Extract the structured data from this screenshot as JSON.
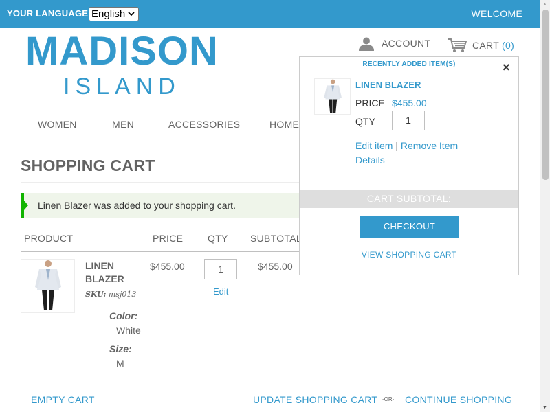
{
  "header": {
    "language_label": "YOUR LANGUAGE:",
    "language_selected": "English",
    "welcome": "WELCOME"
  },
  "logo": {
    "main": "MADISON",
    "sub": "ISLAND"
  },
  "account": {
    "label": "ACCOUNT"
  },
  "cart": {
    "label": "CART",
    "count": "(0)"
  },
  "nav": {
    "items": [
      "WOMEN",
      "MEN",
      "ACCESSORIES",
      "HOME"
    ]
  },
  "page": {
    "title": "SHOPPING CART",
    "success_message": "Linen Blazer was added to your shopping cart."
  },
  "table": {
    "headers": {
      "product": "PRODUCT",
      "price": "PRICE",
      "qty": "QTY",
      "subtotal": "SUBTOTAL"
    },
    "row": {
      "name": "LINEN BLAZER",
      "sku_label": "SKU:",
      "sku": "msj013",
      "color_label": "Color:",
      "color": "White",
      "size_label": "Size:",
      "size": "M",
      "price": "$455.00",
      "qty": "1",
      "edit": "Edit",
      "subtotal": "$455.00"
    }
  },
  "footer": {
    "empty_cart": "EMPTY CART",
    "update_cart": "UPDATE SHOPPING CART",
    "or": "-OR-",
    "continue": "CONTINUE SHOPPING"
  },
  "minicart": {
    "heading": "RECENTLY ADDED ITEM(S)",
    "close": "×",
    "item_name": "LINEN BLAZER",
    "price_label": "PRICE",
    "price": "$455.00",
    "qty_label": "QTY",
    "qty": "1",
    "edit_item": "Edit item",
    "separator": "|",
    "remove_item": "Remove Item",
    "details": "Details",
    "subtotal_label": "CART SUBTOTAL:",
    "checkout": "CHECKOUT",
    "view_cart": "VIEW SHOPPING CART"
  },
  "colors": {
    "accent": "#3399cc",
    "success": "#11b400",
    "text": "#636363"
  }
}
